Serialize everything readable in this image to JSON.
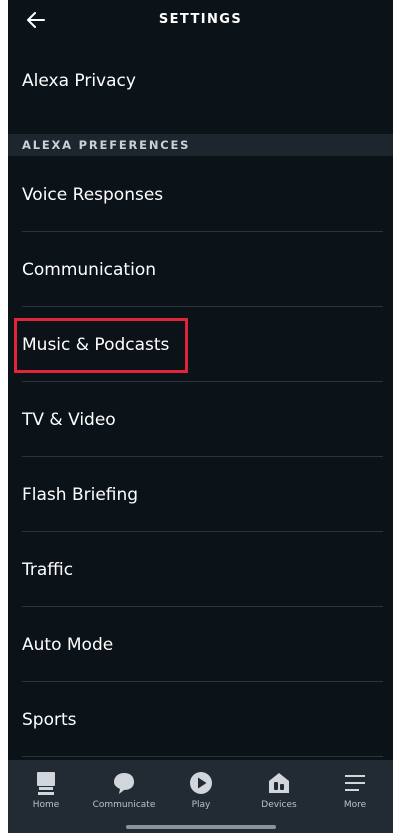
{
  "header": {
    "title": "SETTINGS",
    "back_icon": "arrow-left-icon"
  },
  "privacy_row": {
    "label": "Alexa Privacy"
  },
  "section": {
    "label": "ALEXA PREFERENCES"
  },
  "items": [
    {
      "label": "Voice Responses"
    },
    {
      "label": "Communication"
    },
    {
      "label": "Music & Podcasts",
      "highlighted": true
    },
    {
      "label": "TV & Video"
    },
    {
      "label": "Flash Briefing"
    },
    {
      "label": "Traffic"
    },
    {
      "label": "Auto Mode"
    },
    {
      "label": "Sports"
    }
  ],
  "tabs": [
    {
      "label": "Home",
      "icon": "home-icon"
    },
    {
      "label": "Communicate",
      "icon": "chat-bubble-icon"
    },
    {
      "label": "Play",
      "icon": "play-icon"
    },
    {
      "label": "Devices",
      "icon": "devices-icon"
    },
    {
      "label": "More",
      "icon": "menu-icon"
    }
  ],
  "colors": {
    "background": "#0b1218",
    "section_header_bg": "#1d262e",
    "highlight": "#e0243a",
    "tabbar_bg": "#222b33"
  }
}
